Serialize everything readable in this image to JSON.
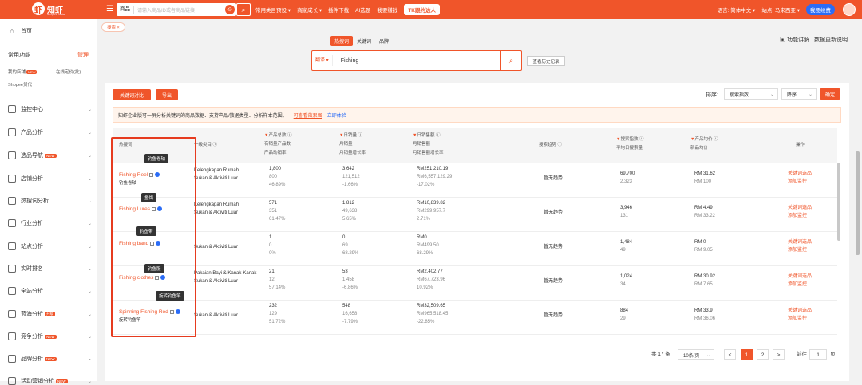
{
  "topbar": {
    "logo_text": "知虾",
    "logo_sub": "shopee data",
    "search_category": "商品",
    "search_placeholder": "请输入商品ID或者商品链接",
    "nav": [
      "常用类目预设 ▾",
      "商家成长 ▾",
      "插件下载",
      "AI选题",
      "我要赚钱"
    ],
    "tk_label": "TK跟约达人",
    "language": "语言: 简体中文 ▾",
    "site": "站点: 马来西亚 ▾",
    "renew": "我要续费"
  },
  "sidebar": {
    "home": "首页",
    "common_title": "常用功能",
    "manage": "管理",
    "quick_links": [
      "我的店铺",
      "在线定价(批)",
      "Shopee货代"
    ],
    "quick_badge": "NEW",
    "items": [
      {
        "label": "监控中心",
        "icon": "monitor-icon",
        "badge": ""
      },
      {
        "label": "产品分析",
        "icon": "box-icon",
        "badge": ""
      },
      {
        "label": "选品导航",
        "icon": "compass-icon",
        "badge": "NEW"
      },
      {
        "label": "店铺分析",
        "icon": "shop-icon",
        "badge": ""
      },
      {
        "label": "热搜词分析",
        "icon": "fire-icon",
        "badge": ""
      },
      {
        "label": "行业分析",
        "icon": "chart-icon",
        "badge": ""
      },
      {
        "label": "站点分析",
        "icon": "site-icon",
        "badge": ""
      },
      {
        "label": "实时排名",
        "icon": "rank-icon",
        "badge": ""
      },
      {
        "label": "全站分析",
        "icon": "globe-icon",
        "badge": ""
      },
      {
        "label": "蓝海分析",
        "icon": "ocean-icon",
        "badge": "升级"
      },
      {
        "label": "竞争分析",
        "icon": "compete-icon",
        "badge": "NEW"
      },
      {
        "label": "品牌分析",
        "icon": "brand-icon",
        "badge": "NEW"
      },
      {
        "label": "活动营销分析",
        "icon": "event-icon",
        "badge": "NEW"
      }
    ]
  },
  "breadcrumb": "搜索 ×",
  "keyword_search": {
    "tabs": [
      "热搜词",
      "关键词",
      "品牌"
    ],
    "sort": "翻译 ▾",
    "value": "Fishing",
    "history": "查看历史记录"
  },
  "func_links": [
    "功能讲解",
    "数据更新说明"
  ],
  "toolbar": {
    "compare": "关键词对比",
    "export": "导出",
    "sort_label": "排序:",
    "sort_field": "搜索指数",
    "sort_order": "降序",
    "confirm": "确定"
  },
  "notice": {
    "text": "知虾企业版可一屏分析关键词的商品数据、支持产品/数据类型、分析样本范围。",
    "link1": "可查看效果图",
    "link2": "立即体验"
  },
  "table": {
    "headers": {
      "keyword": "热搜词",
      "category": "一级类目",
      "products": [
        "产品总数",
        "有销量产品数",
        "产品动销率"
      ],
      "sales": [
        "日销量",
        "月销量",
        "月销量增长率"
      ],
      "revenue": [
        "日销售额",
        "月销售额",
        "月销售额增长率"
      ],
      "trend": "搜索趋势",
      "search": [
        "搜索指数",
        "平均日搜索量"
      ],
      "price": [
        "产品均价",
        "新品均价"
      ],
      "ops": "操作"
    },
    "rows": [
      {
        "kw": "Fishing Reel",
        "cn": "钓鱼卷轴",
        "tooltip": "钓鱼卷轴",
        "cat1": "Kelengkapan Rumah",
        "cat2": "Sukan & Aktiviti Luar",
        "p": [
          "1,800",
          "800",
          "46.89%"
        ],
        "s": [
          "3,642",
          "121,512",
          "-1.66%"
        ],
        "r": [
          "RM251,210.19",
          "RM6,557,129.29",
          "-17.02%"
        ],
        "trend": "暂无趋势",
        "si": [
          "69,700",
          "2,323"
        ],
        "pr": [
          "RM 31.62",
          "RM 100"
        ]
      },
      {
        "kw": "Fishing Lures",
        "cn": "",
        "tooltip": "鱼饵",
        "cat1": "Kelengkapan Rumah",
        "cat2": "Sukan & Aktiviti Luar",
        "p": [
          "571",
          "351",
          "61.47%"
        ],
        "s": [
          "1,812",
          "49,638",
          "5.65%"
        ],
        "r": [
          "RM10,839.82",
          "RM299,957.7",
          "2.71%"
        ],
        "trend": "暂无趋势",
        "si": [
          "3,946",
          "131"
        ],
        "pr": [
          "RM 4.49",
          "RM 33.22"
        ]
      },
      {
        "kw": "Fishing band",
        "cn": "",
        "tooltip": "钓鱼带",
        "cat1": "",
        "cat2": "Sukan & Aktiviti Luar",
        "p": [
          "1",
          "0",
          "0%"
        ],
        "s": [
          "0",
          "69",
          "68.29%"
        ],
        "r": [
          "RM0",
          "RM499.50",
          "68.29%"
        ],
        "trend": "暂无趋势",
        "si": [
          "1,484",
          "49"
        ],
        "pr": [
          "RM 0",
          "RM 9.05"
        ]
      },
      {
        "kw": "Fishing clothes",
        "cn": "",
        "tooltip": "钓鱼服",
        "cat1": "Pakaian Bayi & Kanak-Kanak",
        "cat2": "Sukan & Aktiviti Luar",
        "p": [
          "21",
          "12",
          "57.14%"
        ],
        "s": [
          "53",
          "1,458",
          "-6.86%"
        ],
        "r": [
          "RM2,402.77",
          "RM67,723.96",
          "10.92%"
        ],
        "trend": "暂无趋势",
        "si": [
          "1,024",
          "34"
        ],
        "pr": [
          "RM 30.92",
          "RM 7.65"
        ]
      },
      {
        "kw": "Spinning Fishing Rod",
        "cn": "旋转钓鱼竿",
        "tooltip": "旋转钓鱼竿",
        "cat1": "",
        "cat2": "Sukan & Aktiviti Luar",
        "p": [
          "232",
          "129",
          "51.72%"
        ],
        "s": [
          "548",
          "16,658",
          "-7.79%"
        ],
        "r": [
          "RM32,509.65",
          "RM965,518.45",
          "-22.85%"
        ],
        "trend": "暂无趋势",
        "si": [
          "884",
          "29"
        ],
        "pr": [
          "RM 33.9",
          "RM 36.06"
        ]
      }
    ],
    "op1": "关键词选品",
    "op2": "添加监控"
  },
  "pagination": {
    "total": "共 17 条",
    "page_size": "10条/页",
    "prev": "<",
    "pages": [
      "1",
      "2"
    ],
    "next": ">",
    "goto": "前往",
    "goto_value": "1",
    "page_unit": "页"
  }
}
